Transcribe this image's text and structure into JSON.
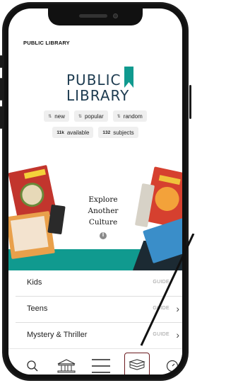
{
  "header": {
    "title": "PUBLIC LIBRARY"
  },
  "logo": {
    "line1": "PUBLIC",
    "line2": "LIBRARY",
    "flag_color": "#109a8f",
    "text_color": "#1d3b50"
  },
  "sort_chips": [
    {
      "icon": "sort-icon",
      "label": "new"
    },
    {
      "icon": "sort-icon",
      "label": "popular"
    },
    {
      "icon": "sort-icon",
      "label": "random"
    }
  ],
  "stats_chips": [
    {
      "count": "11k",
      "label": "available"
    },
    {
      "count": "132",
      "label": "subjects"
    }
  ],
  "hero": {
    "line1": "Explore",
    "line2": "Another",
    "line3": "Culture",
    "band_color": "#109a8f",
    "pause_icon": "pause-icon"
  },
  "categories": [
    {
      "label": "Kids",
      "guide": "GUIDE"
    },
    {
      "label": "Teens",
      "guide": "GUIDE"
    },
    {
      "label": "Mystery & Thriller",
      "guide": "GUIDE"
    }
  ],
  "tabbar": {
    "items": [
      {
        "icon": "search-icon"
      },
      {
        "icon": "library-building-icon"
      },
      {
        "icon": "menu-icon"
      },
      {
        "icon": "books-stack-icon",
        "active": true
      },
      {
        "icon": "clock-icon"
      }
    ],
    "active_color": "#6b1a1f"
  }
}
